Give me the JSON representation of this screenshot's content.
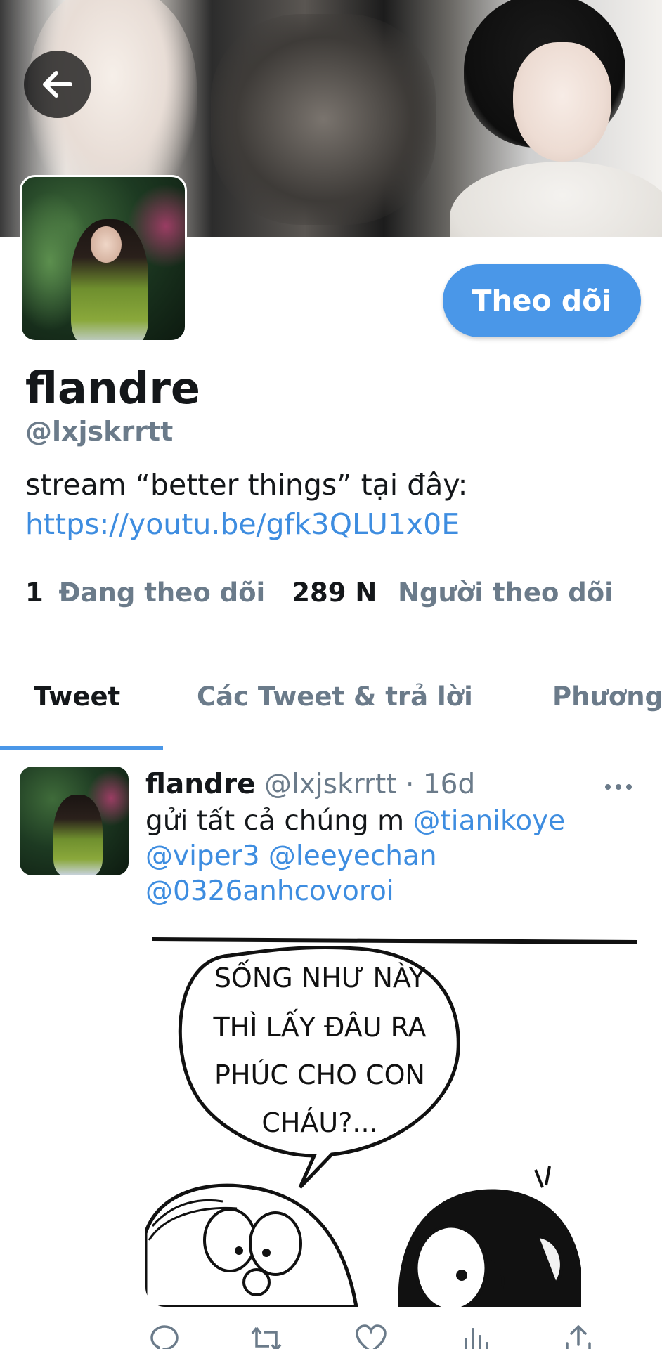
{
  "header": {
    "back_label": "Back"
  },
  "profile": {
    "follow_button": "Theo dõi",
    "name": "flandre",
    "handle": "@lxjskrrtt",
    "bio": "stream “better things” tại đây:",
    "bio_link": "https://youtu.be/gfk3QLU1x0E",
    "following_count": "1",
    "following_label": "Đang theo dõi",
    "followers_count": "289 N",
    "followers_label": "Người theo dõi"
  },
  "tabs": [
    {
      "label": "Tweet",
      "active": true
    },
    {
      "label": "Các Tweet & trả lời",
      "active": false
    },
    {
      "label": "Phương",
      "active": false
    }
  ],
  "tweet": {
    "name": "flandre",
    "handle": "@lxjskrrtt",
    "separator": "·",
    "time": "16d",
    "text": "gửi tất cả chúng m",
    "mentions": [
      "@tianikoye",
      "@viper3",
      "@leeyechan",
      "@0326anhcovoroi"
    ],
    "image_caption_lines": [
      "SỐNG NHƯ NÀY",
      "THÌ LẤY ĐÂU RA",
      "PHÚC CHO CON",
      "CHÁU?..."
    ]
  },
  "icons": {
    "back": "arrow-left-icon",
    "more": "more-horizontal-icon",
    "reply": "reply-icon",
    "retweet": "retweet-icon",
    "like": "heart-icon",
    "analytics": "analytics-icon",
    "share": "share-icon"
  },
  "colors": {
    "accent": "#4a97e8",
    "link": "#3e8de0",
    "muted": "#6b7b8a",
    "text": "#14171a"
  }
}
